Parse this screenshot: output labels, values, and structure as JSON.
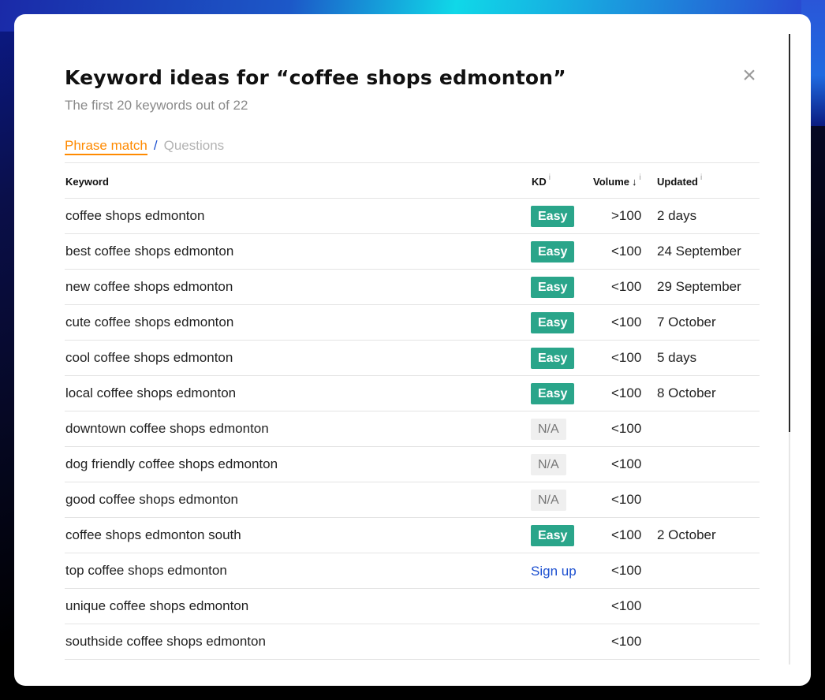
{
  "modal": {
    "title": "Keyword ideas for “coffee shops edmonton”",
    "subtitle": "The first 20 keywords out of 22",
    "close_icon": "×"
  },
  "tabs": {
    "active": "Phrase match",
    "separator": "/",
    "inactive": "Questions"
  },
  "table": {
    "headers": {
      "keyword": "Keyword",
      "kd": "KD",
      "volume": "Volume",
      "updated": "Updated",
      "info_icon": "i",
      "sort_icon": "↓"
    },
    "rows": [
      {
        "keyword": "coffee shops edmonton",
        "kd": "Easy",
        "volume": ">100",
        "updated": "2 days"
      },
      {
        "keyword": "best coffee shops edmonton",
        "kd": "Easy",
        "volume": "<100",
        "updated": "24 September"
      },
      {
        "keyword": "new coffee shops edmonton",
        "kd": "Easy",
        "volume": "<100",
        "updated": "29 September"
      },
      {
        "keyword": "cute coffee shops edmonton",
        "kd": "Easy",
        "volume": "<100",
        "updated": "7 October"
      },
      {
        "keyword": "cool coffee shops edmonton",
        "kd": "Easy",
        "volume": "<100",
        "updated": "5 days"
      },
      {
        "keyword": "local coffee shops edmonton",
        "kd": "Easy",
        "volume": "<100",
        "updated": "8 October"
      },
      {
        "keyword": "downtown coffee shops edmonton",
        "kd": "N/A",
        "volume": "<100",
        "updated": ""
      },
      {
        "keyword": "dog friendly coffee shops edmonton",
        "kd": "N/A",
        "volume": "<100",
        "updated": ""
      },
      {
        "keyword": "good coffee shops edmonton",
        "kd": "N/A",
        "volume": "<100",
        "updated": ""
      },
      {
        "keyword": "coffee shops edmonton south",
        "kd": "Easy",
        "volume": "<100",
        "updated": "2 October"
      },
      {
        "keyword": "top coffee shops edmonton",
        "kd": "Sign up",
        "volume": "<100",
        "updated": ""
      },
      {
        "keyword": "unique coffee shops edmonton",
        "kd": "",
        "volume": "<100",
        "updated": ""
      },
      {
        "keyword": "southside coffee shops edmonton",
        "kd": "",
        "volume": "<100",
        "updated": ""
      }
    ]
  },
  "colors": {
    "accent_orange": "#ff8a00",
    "easy_green": "#2aa58a",
    "link_blue": "#1b4fd0"
  }
}
